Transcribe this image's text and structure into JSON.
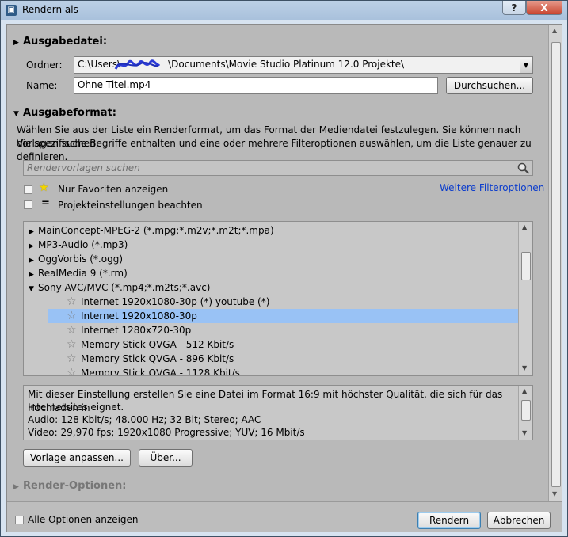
{
  "window": {
    "title": "Rendern als",
    "help_label": "?",
    "close_label": "X"
  },
  "ausgabedatei": {
    "heading": "Ausgabedatei:",
    "ordner_label": "Ordner:",
    "ordner_value_prefix": "C:\\Users\\",
    "ordner_value_suffix": "\\Documents\\Movie Studio Platinum 12.0 Projekte\\",
    "name_label": "Name:",
    "name_value": "Ohne Titel.mp4",
    "browse_label": "Durchsuchen..."
  },
  "ausgabeformat": {
    "heading": "Ausgabeformat:",
    "description_line1": "Wählen Sie aus der Liste ein Renderformat, um das Format der Mediendatei festzulegen. Sie können nach Vorlagen suchen,",
    "description_line2": "die spezifische Begriffe enthalten und eine oder mehrere Filteroptionen auswählen, um die Liste genauer zu definieren.",
    "search_placeholder": "Rendervorlagen suchen",
    "favorites_label": "Nur Favoriten anzeigen",
    "project_settings_label": "Projekteinstellungen beachten",
    "more_filters_link": "Weitere Filteroptionen"
  },
  "format_list": [
    {
      "label": "MainConcept-MPEG-2 (*.mpg;*.m2v;*.m2t;*.mpa)",
      "kind": "group",
      "expanded": false
    },
    {
      "label": "MP3-Audio (*.mp3)",
      "kind": "group",
      "expanded": false
    },
    {
      "label": "OggVorbis (*.ogg)",
      "kind": "group",
      "expanded": false
    },
    {
      "label": "RealMedia 9 (*.rm)",
      "kind": "group",
      "expanded": false
    },
    {
      "label": "Sony AVC/MVC (*.mp4;*.m2ts;*.avc)",
      "kind": "group",
      "expanded": true
    },
    {
      "label": "Internet 1920x1080-30p (*) youtube (*)",
      "kind": "template",
      "selected": false
    },
    {
      "label": "Internet 1920x1080-30p",
      "kind": "template",
      "selected": true
    },
    {
      "label": "Internet 1280x720-30p",
      "kind": "template",
      "selected": false
    },
    {
      "label": "Memory Stick QVGA - 512 Kbit/s",
      "kind": "template",
      "selected": false
    },
    {
      "label": "Memory Stick QVGA - 896 Kbit/s",
      "kind": "template",
      "selected": false
    },
    {
      "label": "Memory Stick QVGA - 1128 Kbit/s",
      "kind": "template",
      "selected": false
    }
  ],
  "info": {
    "line1": "Mit dieser Einstellung erstellen Sie eine Datei im Format 16:9 mit höchster Qualität, die sich für das Hochladen in",
    "line2": "Internetsites eignet.",
    "line3": "Audio: 128 Kbit/s; 48.000 Hz; 32 Bit; Stereo; AAC",
    "line4": "Video: 29,970 fps; 1920x1080 Progressive; YUV; 16 Mbit/s"
  },
  "actions": {
    "customize_label": "Vorlage anpassen...",
    "about_label": "Über..."
  },
  "render_options": {
    "heading": "Render-Optionen:"
  },
  "footer": {
    "show_all_label": "Alle Optionen anzeigen",
    "render_label": "Rendern",
    "cancel_label": "Abbrechen"
  },
  "colors": {
    "selection": "#99c2f5",
    "link": "#0b3ccc",
    "favorite_star": "#f2d500"
  }
}
